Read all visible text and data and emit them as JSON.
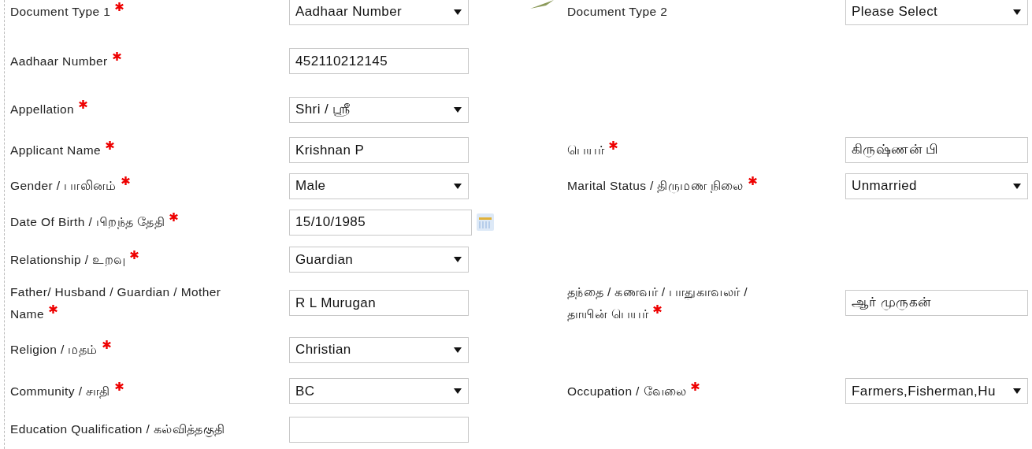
{
  "rows": [
    {
      "left": {
        "label": "Document Type 1",
        "required": true,
        "kind": "select",
        "value": "Aadhaar Number"
      },
      "right": {
        "label": "Document Type 2",
        "required": false,
        "kind": "select",
        "value": "Please Select"
      }
    },
    {
      "left": {
        "label": "Aadhaar Number",
        "required": true,
        "kind": "text",
        "value": "452110212145"
      }
    },
    {
      "left": {
        "label": "Appellation",
        "required": true,
        "kind": "select",
        "value": "Shri / ஸ்ரீ"
      }
    },
    {
      "left": {
        "label": "Applicant Name",
        "required": true,
        "kind": "text",
        "value": "Krishnan P"
      },
      "right": {
        "label": "பெயர்",
        "required": true,
        "kind": "text",
        "value": "கிருஷ்ணன் பி"
      }
    },
    {
      "left": {
        "label": "Gender / பாலினம்",
        "required": true,
        "kind": "select",
        "value": "Male"
      },
      "right": {
        "label": "Marital Status / திருமண நிலை",
        "required": true,
        "kind": "select",
        "value": "Unmarried"
      }
    },
    {
      "left": {
        "label": "Date Of Birth / பிறந்த தேதி",
        "required": true,
        "kind": "date",
        "value": "15/10/1985"
      }
    },
    {
      "left": {
        "label": "Relationship / உறவு",
        "required": true,
        "kind": "select",
        "value": "Guardian"
      }
    },
    {
      "left": {
        "label": "Father/ Husband / Guardian / Mother Name",
        "required": true,
        "kind": "text",
        "value": "R L Murugan"
      },
      "right": {
        "label": "தந்தை / கணவர் / பாதுகாவலர் / தாயின் பெயர்",
        "required": true,
        "kind": "text",
        "value": "ஆர் முருகன்"
      }
    },
    {
      "left": {
        "label": "Religion / மதம்",
        "required": true,
        "kind": "select",
        "value": "Christian"
      }
    },
    {
      "left": {
        "label": "Community / சாதி",
        "required": true,
        "kind": "select",
        "value": "BC"
      },
      "right": {
        "label": "Occupation / வேலை",
        "required": true,
        "kind": "select",
        "value": "Farmers,Fisherman,Hu"
      }
    },
    {
      "left": {
        "label": "Education Qualification / கல்வித்தகுதி",
        "required": false,
        "kind": "text"
      }
    }
  ]
}
